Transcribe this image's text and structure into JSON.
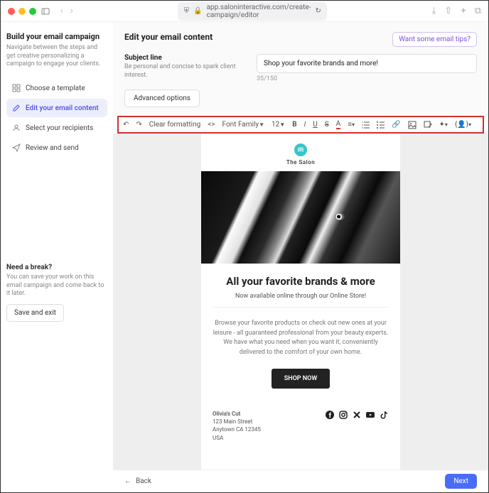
{
  "browser": {
    "url": "app.saloninteractive.com/create-campaign/editor"
  },
  "sidebar": {
    "title": "Build your email campaign",
    "description": "Navigate between the steps and get creative personalizing a campaign to engage your clients.",
    "steps": [
      {
        "label": "Choose a template"
      },
      {
        "label": "Edit your email content"
      },
      {
        "label": "Select your recipients"
      },
      {
        "label": "Review and send"
      }
    ],
    "break": {
      "title": "Need a break?",
      "description": "You can save your work on this email campaign and come back to it later.",
      "button": "Save and exit"
    }
  },
  "header": {
    "title": "Edit your email content",
    "tips_button": "Want some email tips?"
  },
  "subject": {
    "label": "Subject line",
    "help": "Be personal and concise to spark client interest.",
    "value": "Shop your favorite brands and more!",
    "counter": "35/150"
  },
  "advanced_button": "Advanced options",
  "toolbar": {
    "clear": "Clear formatting",
    "font": "Font Family",
    "size": "12"
  },
  "email": {
    "logo_text": "The Salon",
    "headline": "All your favorite brands & more",
    "subheadline": "Now available online through our Online Store!",
    "paragraph": "Browse your favorite products or check out new ones at your leisure - all guaranteed professional from your beauty experts. We have what you need when you want it, conveniently delivered to the comfort of your own home.",
    "cta": "SHOP NOW",
    "address": {
      "name": "Olivia's Cut",
      "street": "123 Main Street",
      "city": "Anytown CA 12345",
      "country": "USA"
    }
  },
  "footer": {
    "back": "Back",
    "next": "Next"
  }
}
